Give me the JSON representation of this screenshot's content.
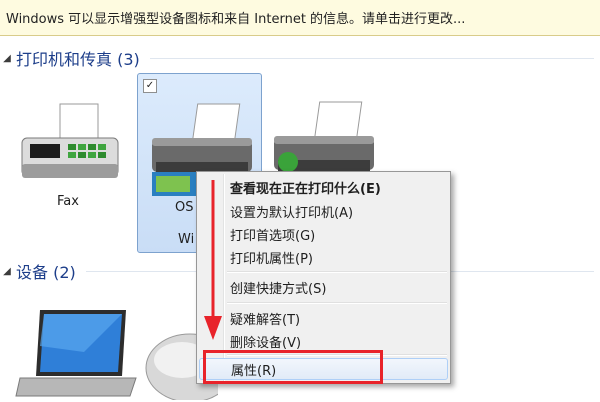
{
  "infobar": {
    "text": "Windows 可以显示增强型设备图标和来自 Internet 的信息。请单击进行更改..."
  },
  "groups": {
    "printers": {
      "title": "打印机和传真 (3)"
    },
    "devices": {
      "title": "设备 (2)"
    }
  },
  "tiles": {
    "fax": {
      "label": "Fax"
    },
    "selected_printer": {
      "checkbox": "✓",
      "label_fragment_1": "OS",
      "label_fragment_2": "Wi"
    }
  },
  "context_menu": {
    "items": [
      {
        "label": "查看现在正在打印什么(E)",
        "bold": true
      },
      {
        "label": "设置为默认打印机(A)"
      },
      {
        "label": "打印首选项(G)"
      },
      {
        "label": "打印机属性(P)"
      },
      {
        "label": "创建快捷方式(S)"
      },
      {
        "label": "疑难解答(T)"
      },
      {
        "label": "删除设备(V)"
      },
      {
        "label": "属性(R)"
      }
    ]
  },
  "annotation": {
    "color": "#e8232a"
  },
  "colors": {
    "header_text": "#1d3e8a",
    "selection": "#c9ddf6",
    "infobar_bg": "#fefbe0"
  }
}
